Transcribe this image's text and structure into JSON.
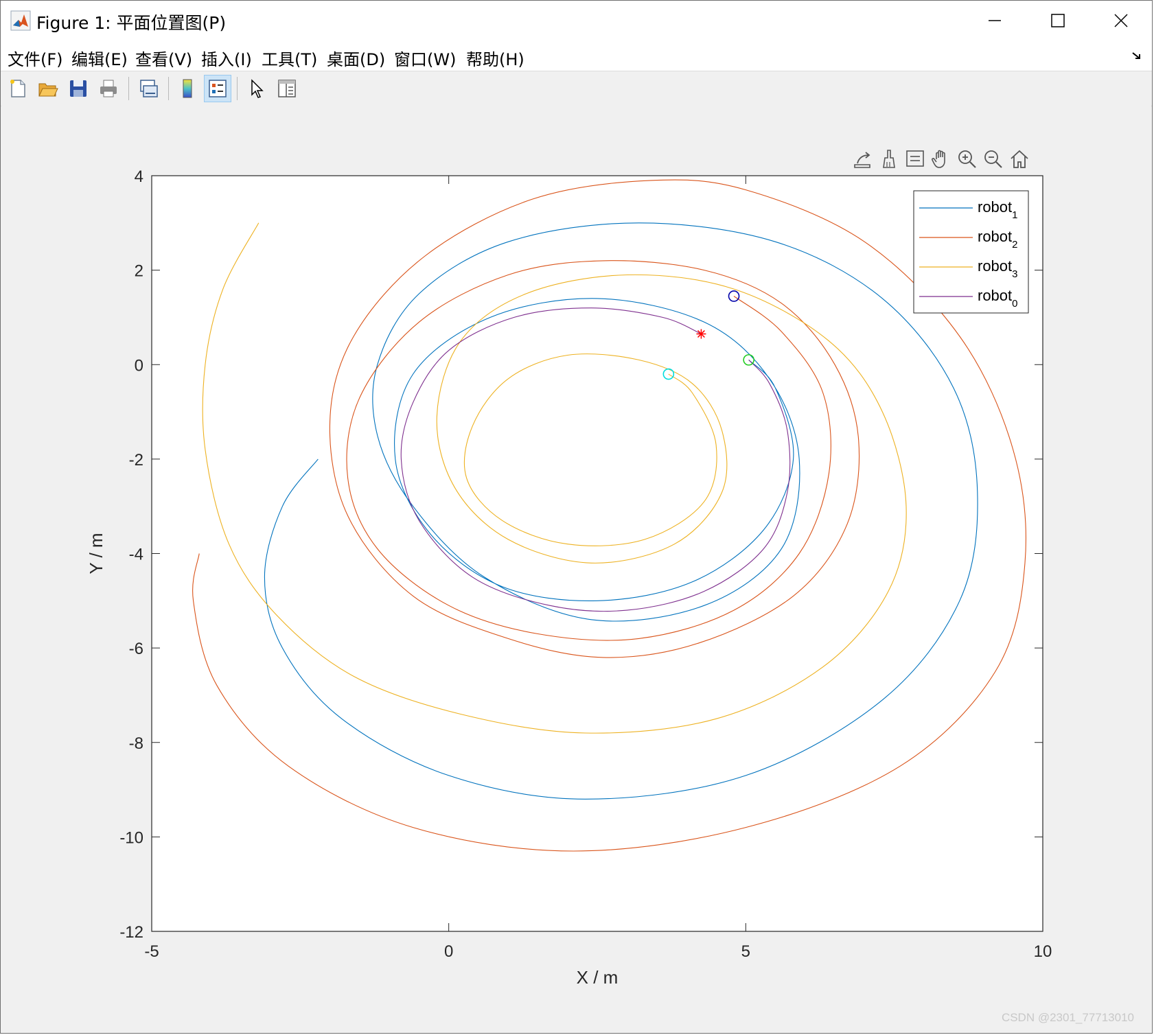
{
  "window": {
    "title": "Figure 1: 平面位置图(P)",
    "minimize_label": "minimize",
    "maximize_label": "maximize",
    "close_label": "close"
  },
  "menu": {
    "items": [
      {
        "label": "文件(F)"
      },
      {
        "label": "编辑(E)"
      },
      {
        "label": "查看(V)"
      },
      {
        "label": "插入(I)"
      },
      {
        "label": "工具(T)"
      },
      {
        "label": "桌面(D)"
      },
      {
        "label": "窗口(W)"
      },
      {
        "label": "帮助(H)"
      }
    ]
  },
  "toolbar": {
    "buttons": [
      {
        "icon": "new-figure-icon"
      },
      {
        "icon": "open-file-icon"
      },
      {
        "icon": "save-icon"
      },
      {
        "icon": "print-icon"
      },
      {
        "icon": "link-plot-icon"
      },
      {
        "icon": "colorbar-icon"
      },
      {
        "icon": "legend-icon",
        "active": true
      },
      {
        "icon": "pointer-icon"
      },
      {
        "icon": "property-inspector-icon"
      }
    ]
  },
  "axes_toolbar": {
    "tools": [
      "export-icon",
      "brush-icon",
      "data-tips-icon",
      "pan-icon",
      "zoom-in-icon",
      "zoom-out-icon",
      "home-icon"
    ]
  },
  "watermark": "CSDN @2301_77713010",
  "colors": {
    "robot1": "#0072BD",
    "robot2": "#D95319",
    "robot3": "#EDB120",
    "robot0": "#7E2F8E",
    "target_star": "#FF0000",
    "marker_blue": "#0000AA",
    "marker_green": "#22CC22",
    "marker_cyan": "#00DDDD"
  },
  "chart_data": {
    "type": "line",
    "xlabel": "X / m",
    "ylabel": "Y / m",
    "xlim": [
      -5,
      10
    ],
    "ylim": [
      -12,
      4
    ],
    "xticks": [
      -5,
      0,
      5,
      10
    ],
    "yticks": [
      4,
      2,
      0,
      -2,
      -4,
      -6,
      -8,
      -10,
      -12
    ],
    "grid": false,
    "legend_position": "top-right",
    "series": [
      {
        "name": "robot1",
        "name_base": "robot",
        "name_sub": "1",
        "color": "#0072BD",
        "points": [
          [
            -2.2,
            -2.0
          ],
          [
            -2.8,
            -3.0
          ],
          [
            -3.1,
            -4.5
          ],
          [
            -2.8,
            -6.0
          ],
          [
            -1.8,
            -7.5
          ],
          [
            0.0,
            -8.7
          ],
          [
            2.3,
            -9.2
          ],
          [
            5.0,
            -8.7
          ],
          [
            7.3,
            -7.1
          ],
          [
            8.6,
            -5.0
          ],
          [
            8.9,
            -2.7
          ],
          [
            8.5,
            -0.5
          ],
          [
            7.3,
            1.4
          ],
          [
            5.5,
            2.6
          ],
          [
            3.2,
            3.0
          ],
          [
            1.0,
            2.6
          ],
          [
            -0.5,
            1.5
          ],
          [
            -1.2,
            0.0
          ],
          [
            -1.2,
            -1.5
          ],
          [
            -0.6,
            -3.0
          ],
          [
            0.6,
            -4.5
          ],
          [
            2.4,
            -5.4
          ],
          [
            4.3,
            -5.1
          ],
          [
            5.6,
            -3.9
          ],
          [
            5.9,
            -2.0
          ],
          [
            5.4,
            -0.3
          ],
          [
            4.3,
            0.9
          ],
          [
            2.5,
            1.4
          ],
          [
            0.7,
            1.0
          ],
          [
            -0.6,
            -0.2
          ],
          [
            -0.9,
            -2.0
          ],
          [
            -0.3,
            -3.6
          ],
          [
            0.9,
            -4.7
          ],
          [
            2.5,
            -5.0
          ],
          [
            4.1,
            -4.6
          ],
          [
            5.3,
            -3.5
          ],
          [
            5.8,
            -2.0
          ],
          [
            5.5,
            -0.5
          ],
          [
            5.05,
            0.1
          ]
        ]
      },
      {
        "name": "robot2",
        "name_base": "robot",
        "name_sub": "2",
        "color": "#D95319",
        "points": [
          [
            -4.2,
            -4.0
          ],
          [
            -4.3,
            -5.0
          ],
          [
            -3.9,
            -6.8
          ],
          [
            -2.7,
            -8.5
          ],
          [
            -0.6,
            -9.8
          ],
          [
            2.1,
            -10.3
          ],
          [
            5.0,
            -9.8
          ],
          [
            7.6,
            -8.5
          ],
          [
            9.2,
            -6.5
          ],
          [
            9.7,
            -4.2
          ],
          [
            9.5,
            -1.8
          ],
          [
            8.6,
            0.6
          ],
          [
            7.0,
            2.6
          ],
          [
            5.0,
            3.7
          ],
          [
            3.4,
            3.9
          ],
          [
            1.4,
            3.5
          ],
          [
            -0.4,
            2.3
          ],
          [
            -1.6,
            0.6
          ],
          [
            -2.0,
            -1.2
          ],
          [
            -1.7,
            -3.2
          ],
          [
            -0.6,
            -4.9
          ],
          [
            1.0,
            -5.8
          ],
          [
            2.6,
            -6.2
          ],
          [
            4.2,
            -5.9
          ],
          [
            5.8,
            -4.9
          ],
          [
            6.7,
            -3.4
          ],
          [
            6.9,
            -1.6
          ],
          [
            6.5,
            0.0
          ],
          [
            5.6,
            1.3
          ],
          [
            4.3,
            2.0
          ],
          [
            2.6,
            2.2
          ],
          [
            1.0,
            1.9
          ],
          [
            -0.5,
            0.9
          ],
          [
            -1.5,
            -0.7
          ],
          [
            -1.7,
            -2.4
          ],
          [
            -1.2,
            -3.9
          ],
          [
            0.0,
            -5.1
          ],
          [
            1.5,
            -5.7
          ],
          [
            3.2,
            -5.8
          ],
          [
            4.8,
            -5.2
          ],
          [
            5.9,
            -4.0
          ],
          [
            6.4,
            -2.3
          ],
          [
            6.3,
            -0.6
          ],
          [
            5.6,
            0.7
          ],
          [
            4.8,
            1.45
          ]
        ]
      },
      {
        "name": "robot3",
        "name_base": "robot",
        "name_sub": "3",
        "color": "#EDB120",
        "points": [
          [
            -3.2,
            3.0
          ],
          [
            -3.8,
            1.6
          ],
          [
            -4.1,
            0.0
          ],
          [
            -4.1,
            -1.8
          ],
          [
            -3.7,
            -3.8
          ],
          [
            -2.9,
            -5.3
          ],
          [
            -1.6,
            -6.6
          ],
          [
            0.2,
            -7.4
          ],
          [
            2.3,
            -7.8
          ],
          [
            4.5,
            -7.5
          ],
          [
            6.3,
            -6.4
          ],
          [
            7.4,
            -4.8
          ],
          [
            7.7,
            -3.0
          ],
          [
            7.3,
            -1.0
          ],
          [
            6.4,
            0.5
          ],
          [
            4.8,
            1.6
          ],
          [
            3.0,
            1.9
          ],
          [
            1.3,
            1.5
          ],
          [
            0.2,
            0.5
          ],
          [
            -0.2,
            -1.1
          ],
          [
            0.1,
            -2.6
          ],
          [
            1.0,
            -3.7
          ],
          [
            2.4,
            -4.2
          ],
          [
            3.8,
            -3.8
          ],
          [
            4.6,
            -2.7
          ],
          [
            4.6,
            -1.4
          ],
          [
            4.1,
            -0.4
          ],
          [
            3.2,
            0.1
          ],
          [
            2.0,
            0.2
          ],
          [
            1.0,
            -0.3
          ],
          [
            0.4,
            -1.3
          ],
          [
            0.3,
            -2.4
          ],
          [
            0.9,
            -3.3
          ],
          [
            2.0,
            -3.8
          ],
          [
            3.3,
            -3.7
          ],
          [
            4.3,
            -2.9
          ],
          [
            4.5,
            -1.7
          ],
          [
            4.1,
            -0.6
          ],
          [
            3.7,
            -0.2
          ]
        ]
      },
      {
        "name": "robot0",
        "name_base": "robot",
        "name_sub": "0",
        "color": "#7E2F8E",
        "points": [
          [
            4.25,
            0.65
          ],
          [
            3.6,
            1.0
          ],
          [
            2.4,
            1.2
          ],
          [
            1.1,
            1.0
          ],
          [
            0.0,
            0.3
          ],
          [
            -0.6,
            -0.8
          ],
          [
            -0.8,
            -2.0
          ],
          [
            -0.5,
            -3.3
          ],
          [
            0.4,
            -4.5
          ],
          [
            1.7,
            -5.1
          ],
          [
            3.0,
            -5.2
          ],
          [
            4.3,
            -4.8
          ],
          [
            5.3,
            -3.9
          ],
          [
            5.7,
            -2.7
          ],
          [
            5.7,
            -1.4
          ],
          [
            5.4,
            -0.4
          ],
          [
            5.05,
            0.1
          ]
        ]
      }
    ],
    "markers": [
      {
        "type": "star",
        "x": 4.25,
        "y": 0.65,
        "color": "#FF0000"
      },
      {
        "type": "circle",
        "x": 4.8,
        "y": 1.45,
        "color": "#0000AA"
      },
      {
        "type": "circle",
        "x": 5.05,
        "y": 0.1,
        "color": "#22CC22"
      },
      {
        "type": "circle",
        "x": 3.7,
        "y": -0.2,
        "color": "#00DDDD"
      }
    ]
  }
}
